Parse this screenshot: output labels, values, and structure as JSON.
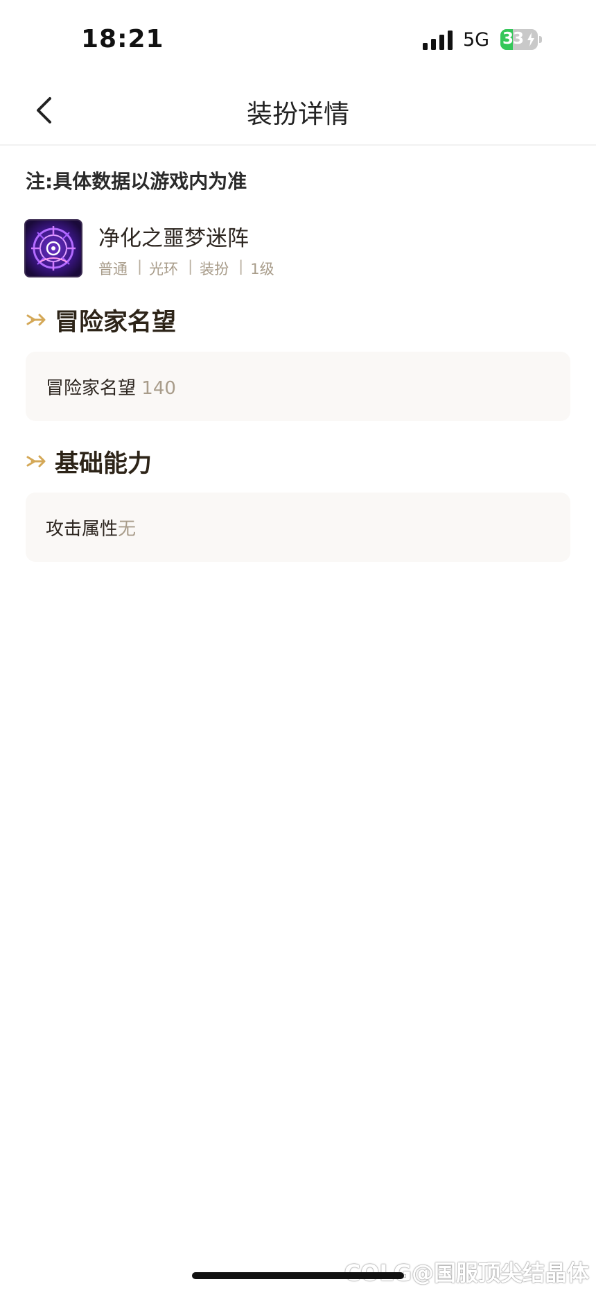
{
  "status_bar": {
    "time": "18:21",
    "network": "5G",
    "battery_level": "33",
    "battery_percent": 33,
    "charging": true
  },
  "header": {
    "title": "装扮详情",
    "back_icon": "chevron-left-icon"
  },
  "note": "注:具体数据以游戏内为准",
  "item": {
    "name": "净化之噩梦迷阵",
    "icon": "purple-magic-circle-icon",
    "tags": [
      "普通",
      "光环",
      "装扮",
      "1级"
    ],
    "separator": "|"
  },
  "sections": [
    {
      "title": "冒险家名望",
      "label": "冒险家名望",
      "value": " 140"
    },
    {
      "title": "基础能力",
      "label": "攻击属性",
      "value": "无"
    }
  ],
  "watermark": "COLG@国服顶尖结晶体",
  "colors": {
    "accent_gold": "#d4a857",
    "text_dark": "#2d2620",
    "text_muted": "#a89c8a",
    "card_bg": "#faf8f6",
    "battery_green": "#34c759"
  }
}
